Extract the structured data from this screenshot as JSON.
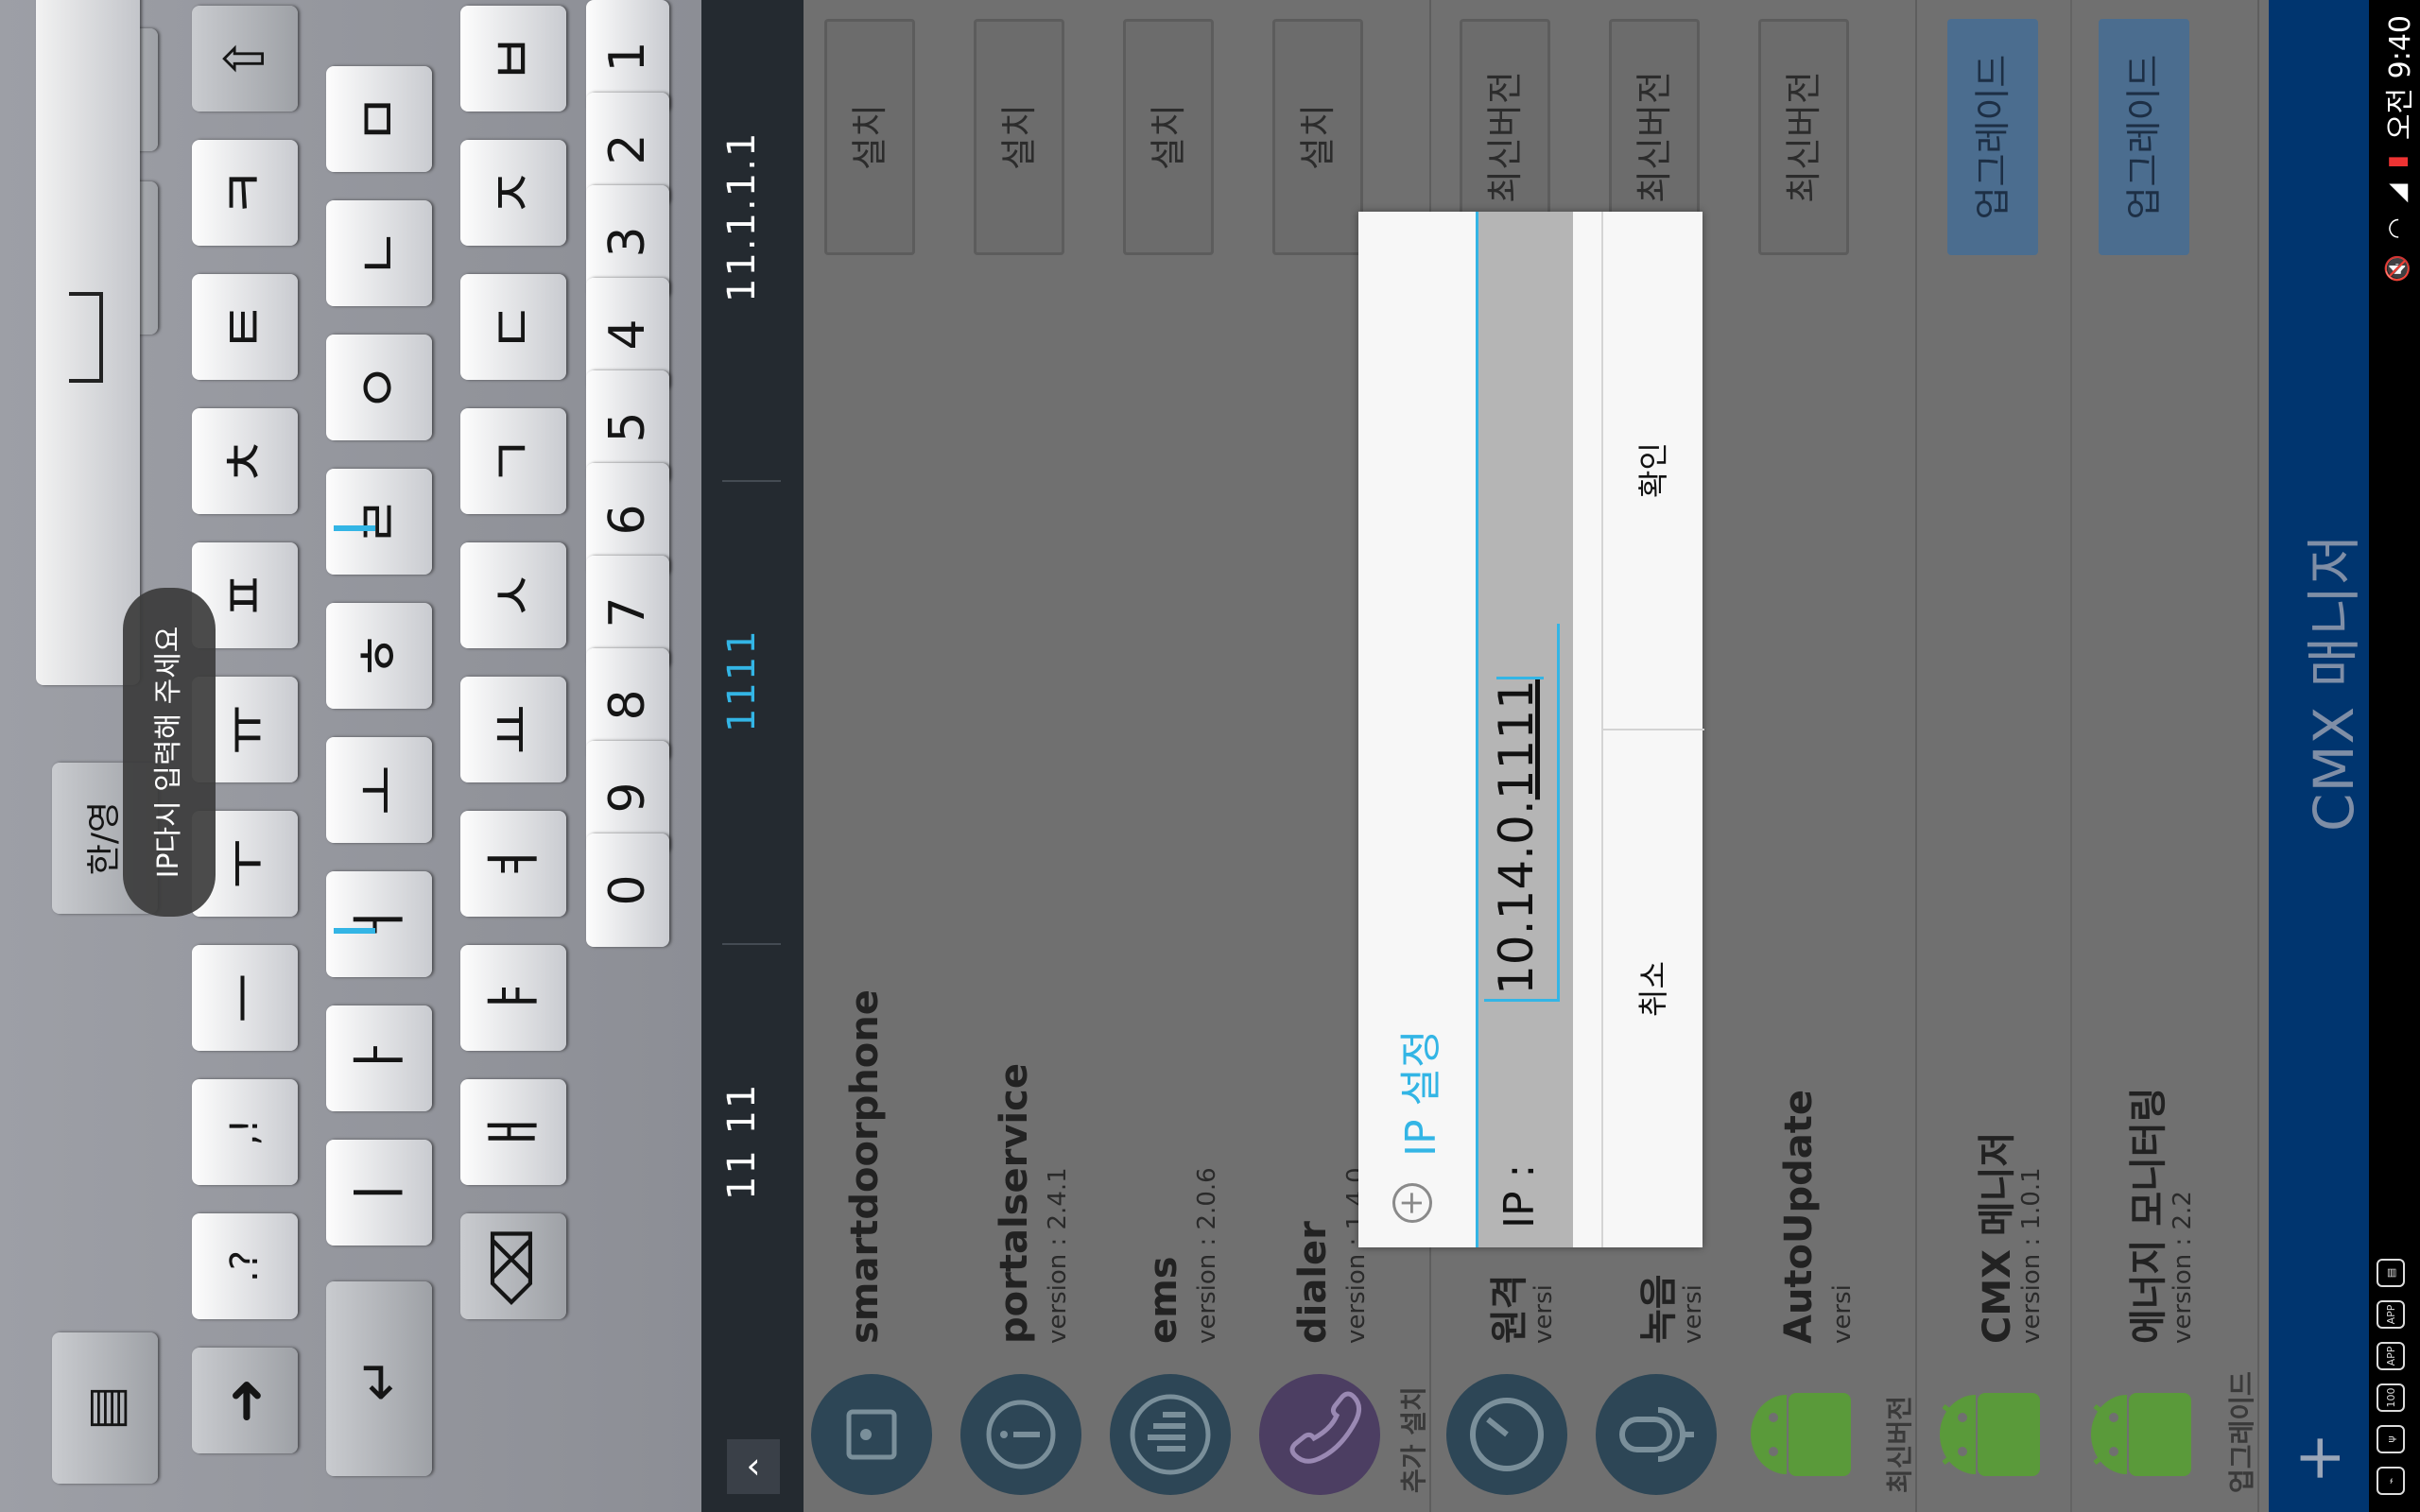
{
  "status_bar": {
    "time": "오전 9:40",
    "left_icons": [
      "usb-icon",
      "usb-icon",
      "notification-badge-icon",
      "apps-icon",
      "apps-icon",
      "storage-icon"
    ],
    "right_icons": [
      "battery-icon",
      "signal-icon",
      "wifi-icon",
      "mute-icon"
    ]
  },
  "action_bar": {
    "title": "CMX 매니저",
    "add_label": "+"
  },
  "sections": [
    {
      "header": "업그레이드",
      "apps": [
        {
          "name": "에너지 모니터링",
          "version": "version : 2.2",
          "button": "업그레이드",
          "icon": "android-icon"
        },
        {
          "name": "CMX 메니저",
          "version": "version : 1.0.1",
          "button": "업그레이드",
          "icon": "android-icon"
        }
      ]
    },
    {
      "header": "최신버전",
      "apps": [
        {
          "name": "AutoUpdate",
          "version": "versi",
          "button": "최신버전",
          "icon": "android-icon"
        },
        {
          "name": "녹음",
          "version": "versi",
          "button": "최신버전",
          "icon": "microphone-icon"
        },
        {
          "name": "원격",
          "version": "versi",
          "button": "최신버전",
          "icon": "gauge-icon"
        }
      ]
    },
    {
      "header": "추가 설치",
      "apps": [
        {
          "name": "dialer",
          "version": "version : 1.4.0",
          "button": "설치",
          "icon": "phone-icon"
        },
        {
          "name": "ems",
          "version": "version : 2.0.6",
          "button": "설치",
          "icon": "ems-icon"
        },
        {
          "name": "portalservice",
          "version": "version : 2.4.1",
          "button": "설치",
          "icon": "info-icon"
        },
        {
          "name": "smartdoorphone",
          "version": "",
          "button": "설치",
          "icon": "doorphone-icon"
        }
      ]
    }
  ],
  "dialog": {
    "title": "IP 설정",
    "icon": "add-circle-icon",
    "label": "IP :",
    "value_prefix": "10.14.0.",
    "value_composing": "1111",
    "cancel_label": "취소",
    "ok_label": "확인"
  },
  "suggestions": {
    "items": [
      "11.1.1.1",
      "1111",
      "11 11"
    ],
    "collapse_label": "‹"
  },
  "keyboard": {
    "toast": "IP다시 입력해 주세요",
    "number_row": [
      "1",
      "2",
      "3",
      "4",
      "5",
      "6",
      "7",
      "8",
      "9",
      "0"
    ],
    "row1": [
      "ㅂ",
      "ㅈ",
      "ㄷ",
      "ㄱ",
      "ㅅ",
      "ㅛ",
      "ㅕ",
      "ㅑ",
      "ㅐ",
      "ㅔ"
    ],
    "row2": [
      "ㅁ",
      "ㄴ",
      "ㅇ",
      "ㄹ",
      "ㅎ",
      "ㅗ",
      "ㅓ",
      "ㅏ",
      "ㅣ"
    ],
    "row3": [
      "ㅋ",
      "ㅌ",
      "ㅊ",
      "ㅍ",
      "ㅠ",
      "ㅜ",
      "ㅡ",
      ",!",
      ".?"
    ],
    "symbols_label": "기호",
    "lang_label": "한/영",
    "shift_icon": "shift-icon",
    "backspace_icon": "backspace-icon",
    "enter_icon": "enter-icon",
    "right_arrow_icon": "arrow-right-icon",
    "keyboard_settings_icon": "keyboard-icon",
    "clipboard_icon": "clipboard-icon"
  }
}
